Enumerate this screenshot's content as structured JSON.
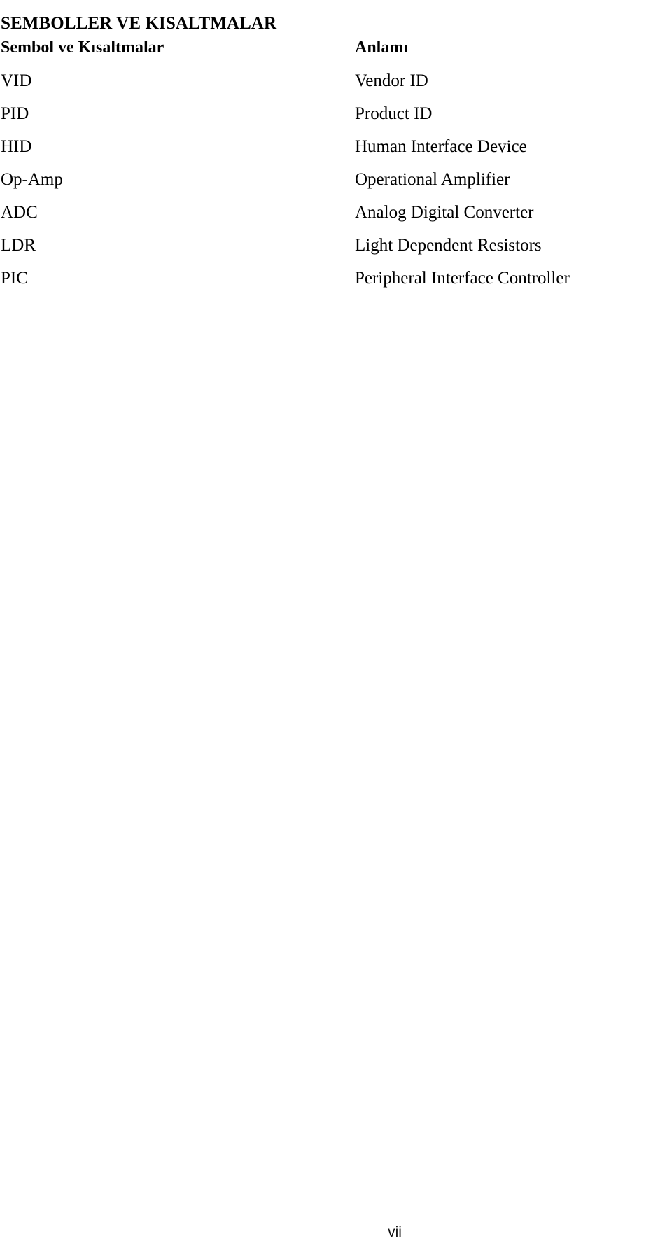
{
  "document": {
    "title": "SEMBOLLER VE KISALTMALAR",
    "page_number": "vii"
  },
  "table": {
    "headers": {
      "symbol": "Sembol ve Kısaltmalar",
      "meaning": "Anlamı"
    },
    "rows": [
      {
        "symbol": "VID",
        "meaning": "Vendor ID"
      },
      {
        "symbol": "PID",
        "meaning": "Product ID"
      },
      {
        "symbol": "HID",
        "meaning": "Human Interface Device"
      },
      {
        "symbol": "Op-Amp",
        "meaning": "Operational Amplifier"
      },
      {
        "symbol": "ADC",
        "meaning": "Analog Digital Converter"
      },
      {
        "symbol": "LDR",
        "meaning": "Light Dependent Resistors"
      },
      {
        "symbol": "PIC",
        "meaning": "Peripheral Interface Controller"
      }
    ]
  },
  "colors": {
    "background": "#ffffff",
    "text": "#000000",
    "footer_text": "#111111"
  }
}
